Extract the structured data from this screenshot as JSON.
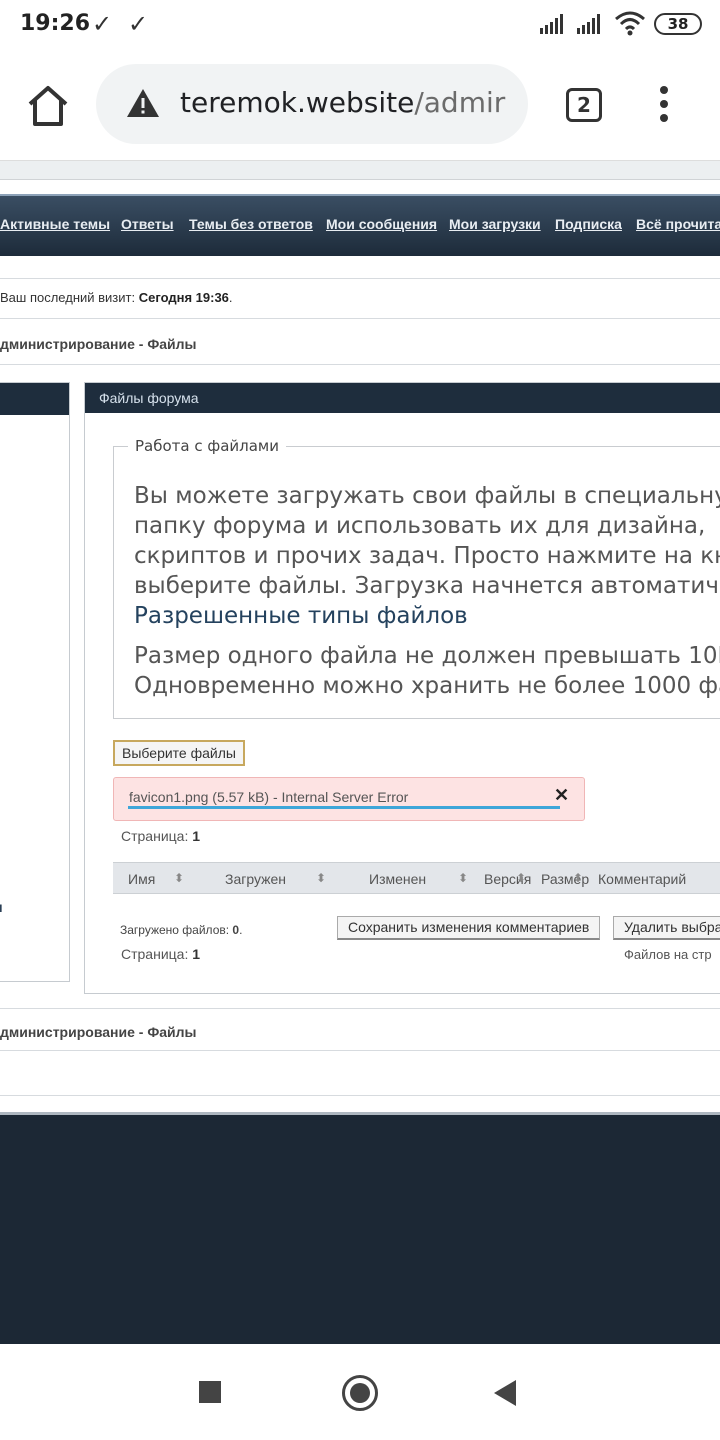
{
  "status_bar": {
    "time": "19:26",
    "battery": "38"
  },
  "browser": {
    "url_host": "teremok.website",
    "url_path": "/admir",
    "tab_count": "2"
  },
  "nav_links": [
    "Активные темы",
    "Ответы",
    "Темы без ответов",
    "Мои сообщения",
    "Мои загрузки",
    "Подписка",
    "Всё прочитан"
  ],
  "last_visit": {
    "label": "Ваш последний визит: ",
    "value": "Сегодня 19:36",
    "suffix": "."
  },
  "breadcrumb": "дминистрирование - Файлы",
  "left_panel": {
    "fragment": "и"
  },
  "panel": {
    "title": "Файлы форума",
    "fieldset_legend": "Работа с файлами",
    "para1_lines": [
      "Вы можете загружать свои файлы в специальную",
      "папку форума и использовать их для дизайна,",
      "скриптов и прочих задач. Просто нажмите на кно",
      "выберите файлы. Загрузка начнется автоматиче"
    ],
    "allowed_types_link": "Разрешенные типы файлов",
    "para2_lines": [
      "Размер одного файла не должен превышать 10М",
      "Одновременно можно хранить не более 1000 фай"
    ],
    "choose_files_button": "Выберите файлы",
    "upload_error": "favicon1.png (5.57 kB) - Internal Server Error",
    "page_label": "Страница: ",
    "page_number": "1",
    "columns": [
      "Имя",
      "Загружен",
      "Изменен",
      "Версия",
      "Размер",
      "Комментарий"
    ],
    "uploaded_label": "Загружено файлов: ",
    "uploaded_count": "0",
    "uploaded_suffix": ".",
    "save_comments_button": "Сохранить изменения комментариев",
    "delete_selected_button": "Удалить выбра",
    "files_per_page": "Файлов на стр"
  },
  "breadcrumb_bottom": "дминистрирование - Файлы"
}
